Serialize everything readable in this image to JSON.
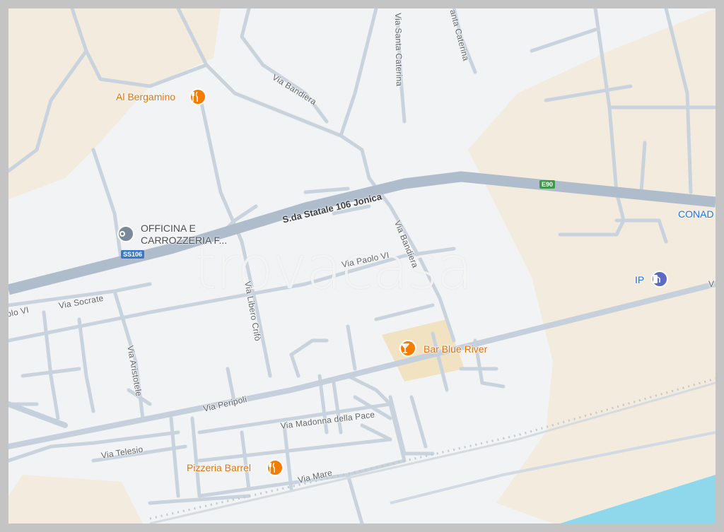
{
  "colors": {
    "land": "#f1f3f4",
    "sand": "#f5ecdd",
    "road": "#c9d3de",
    "highway": "#aebccb",
    "sea": "#8fd8ec",
    "poi_orange": "#e8710a",
    "poi_blue": "#1a73e8"
  },
  "watermark": "trovacasa",
  "highway": {
    "name": "S.da Statale 106 Jonica",
    "shield_ss": "SS106",
    "shield_e": "E90"
  },
  "streets": {
    "santa_caterina_1": "Via Santa Caterina",
    "santa_caterina_2": "anta Caterina",
    "bandiera_1": "Via Bandiera",
    "bandiera_2": "Via Bandiera",
    "paolo_vi_1": "Via Paolo VI",
    "paolo_vi_2": "olo VI",
    "socrate": "Via Socrate",
    "libero_crifo": "Via Libero Crifò",
    "aristotele": "Via Aristotele",
    "peripoli": "Via Peripoli",
    "madonna_pace": "Via Madonna della Pace",
    "telesio": "Via Telesio",
    "mare": "Via Mare",
    "edge_v": "V"
  },
  "pois": {
    "al_bergamino": {
      "name": "Al Bergamino",
      "icon": "restaurant-icon"
    },
    "officina": {
      "line1": "OFFICINA E",
      "line2": "CARROZZERIA F...",
      "icon": "place-pin-icon"
    },
    "bar_blue_river": {
      "name": "Bar Blue River",
      "icon": "cocktail-bar-icon"
    },
    "pizzeria_barrel": {
      "name": "Pizzeria Barrel",
      "icon": "restaurant-icon"
    },
    "ip": {
      "name": "IP",
      "icon": "gas-station-icon"
    },
    "conad": {
      "name": "CONAD"
    }
  }
}
